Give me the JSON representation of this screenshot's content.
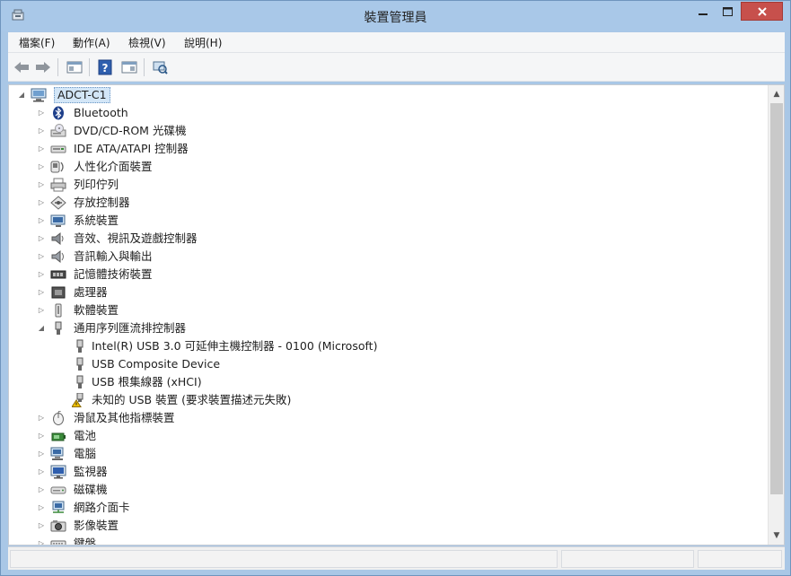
{
  "window": {
    "title": "裝置管理員"
  },
  "menu": [
    {
      "label": "檔案(F)"
    },
    {
      "label": "動作(A)"
    },
    {
      "label": "檢視(V)"
    },
    {
      "label": "說明(H)"
    }
  ],
  "toolbar": {
    "buttons": [
      "back-arrow-icon",
      "forward-arrow-icon",
      "properties-pane-icon",
      "help-icon",
      "view-pane-icon",
      "scan-hardware-icon"
    ]
  },
  "tree": {
    "root": {
      "label": "ADCT-C1",
      "expanded": true
    },
    "items": [
      {
        "label": "Bluetooth",
        "icon": "bluetooth-icon",
        "expanded": false
      },
      {
        "label": "DVD/CD-ROM 光碟機",
        "icon": "dvd-drive-icon",
        "expanded": false
      },
      {
        "label": "IDE ATA/ATAPI 控制器",
        "icon": "ide-controller-icon",
        "expanded": false
      },
      {
        "label": "人性化介面裝置",
        "icon": "hid-icon",
        "expanded": false
      },
      {
        "label": "列印佇列",
        "icon": "printer-icon",
        "expanded": false
      },
      {
        "label": "存放控制器",
        "icon": "storage-controller-icon",
        "expanded": false
      },
      {
        "label": "系統裝置",
        "icon": "system-device-icon",
        "expanded": false
      },
      {
        "label": "音效、視訊及遊戲控制器",
        "icon": "sound-icon",
        "expanded": false
      },
      {
        "label": "音訊輸入與輸出",
        "icon": "audio-io-icon",
        "expanded": false
      },
      {
        "label": "記憶體技術裝置",
        "icon": "memory-device-icon",
        "expanded": false
      },
      {
        "label": "處理器",
        "icon": "processor-icon",
        "expanded": false
      },
      {
        "label": "軟體裝置",
        "icon": "software-device-icon",
        "expanded": false
      },
      {
        "label": "通用序列匯流排控制器",
        "icon": "usb-controller-icon",
        "expanded": true,
        "children": [
          {
            "label": "Intel(R) USB 3.0 可延伸主機控制器 - 0100 (Microsoft)",
            "icon": "usb-plug-icon"
          },
          {
            "label": "USB Composite Device",
            "icon": "usb-plug-icon"
          },
          {
            "label": "USB 根集線器 (xHCI)",
            "icon": "usb-plug-icon"
          },
          {
            "label": "未知的 USB 裝置 (要求裝置描述元失敗)",
            "icon": "usb-warning-icon"
          }
        ]
      },
      {
        "label": "滑鼠及其他指標裝置",
        "icon": "mouse-icon",
        "expanded": false
      },
      {
        "label": "電池",
        "icon": "battery-icon",
        "expanded": false
      },
      {
        "label": "電腦",
        "icon": "computer-icon",
        "expanded": false
      },
      {
        "label": "監視器",
        "icon": "monitor-icon",
        "expanded": false
      },
      {
        "label": "磁碟機",
        "icon": "disk-drive-icon",
        "expanded": false
      },
      {
        "label": "網路介面卡",
        "icon": "network-adapter-icon",
        "expanded": false
      },
      {
        "label": "影像裝置",
        "icon": "imaging-device-icon",
        "expanded": false
      },
      {
        "label": "鍵盤",
        "icon": "keyboard-icon",
        "expanded": false
      }
    ]
  },
  "colors": {
    "accent": "#a9c8e8",
    "close": "#c7504c",
    "selection": "#d3e6f7",
    "warning": "#f2c200"
  }
}
